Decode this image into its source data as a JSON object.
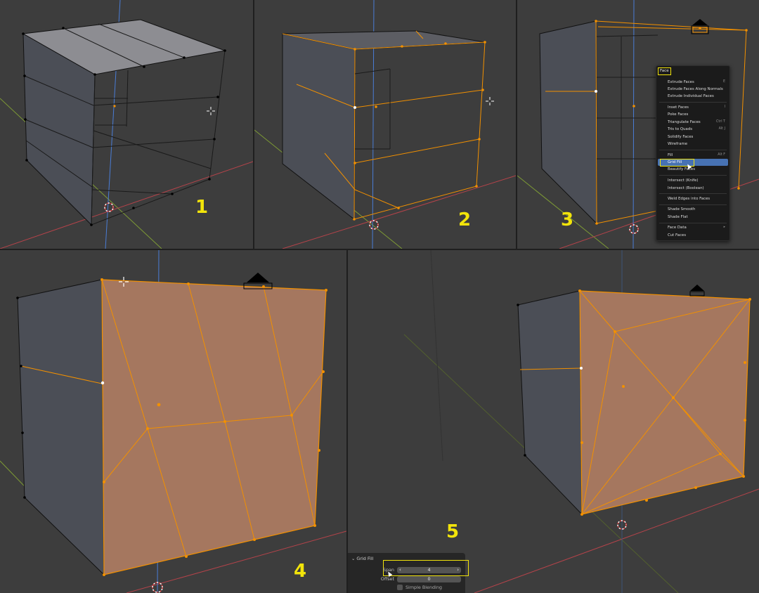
{
  "steps": [
    "1",
    "2",
    "3",
    "4",
    "5"
  ],
  "context_menu": {
    "title": "Face",
    "items": [
      {
        "label": "Extrude Faces",
        "shortcut": "E"
      },
      {
        "label": "Extrude Faces Along Normals",
        "shortcut": ""
      },
      {
        "label": "Extrude Individual Faces",
        "shortcut": ""
      },
      {
        "label": "Inset Faces",
        "shortcut": "I"
      },
      {
        "label": "Poke Faces",
        "shortcut": ""
      },
      {
        "label": "Triangulate Faces",
        "shortcut": "Ctrl T"
      },
      {
        "label": "Tris to Quads",
        "shortcut": "Alt J"
      },
      {
        "label": "Solidify Faces",
        "shortcut": ""
      },
      {
        "label": "Wireframe",
        "shortcut": ""
      },
      {
        "label": "Fill",
        "shortcut": "Alt F"
      },
      {
        "label": "Grid Fill",
        "shortcut": ""
      },
      {
        "label": "Beautify Faces",
        "shortcut": ""
      },
      {
        "label": "Intersect (Knife)",
        "shortcut": ""
      },
      {
        "label": "Intersect (Boolean)",
        "shortcut": ""
      },
      {
        "label": "Weld Edges into Faces",
        "shortcut": ""
      },
      {
        "label": "Shade Smooth",
        "shortcut": ""
      },
      {
        "label": "Shade Flat",
        "shortcut": ""
      },
      {
        "label": "Face Data",
        "shortcut": "▸"
      },
      {
        "label": "Cut Faces",
        "shortcut": ""
      }
    ],
    "selected_index": 10
  },
  "operator_panel": {
    "title": "Grid Fill",
    "span_label": "Span",
    "span_value": "4",
    "offset_label": "Offset",
    "offset_value": "0",
    "simple_blending_label": "Simple Blending",
    "simple_blending_checked": false
  },
  "colors": {
    "viewport_bg": "#3d3d3d",
    "panel_gap": "#1f1f1f",
    "mesh_side": "#4a4d55",
    "mesh_top": "#8a8a8f",
    "selected_edge": "#f29000",
    "selected_face": "#a8775e",
    "x_axis": "#c2454d",
    "y_axis": "#8aab3a",
    "z_axis": "#4a7dd6",
    "highlight": "#f2e40a",
    "menu_bg": "#1b1b1b",
    "menu_selected": "#4772b3"
  },
  "icons": [
    "3d-cursor-icon",
    "crosshair-cursor-icon",
    "mouse-pointer-icon",
    "chevron-down-icon",
    "chevron-left-icon",
    "chevron-right-icon",
    "camera-icon"
  ]
}
